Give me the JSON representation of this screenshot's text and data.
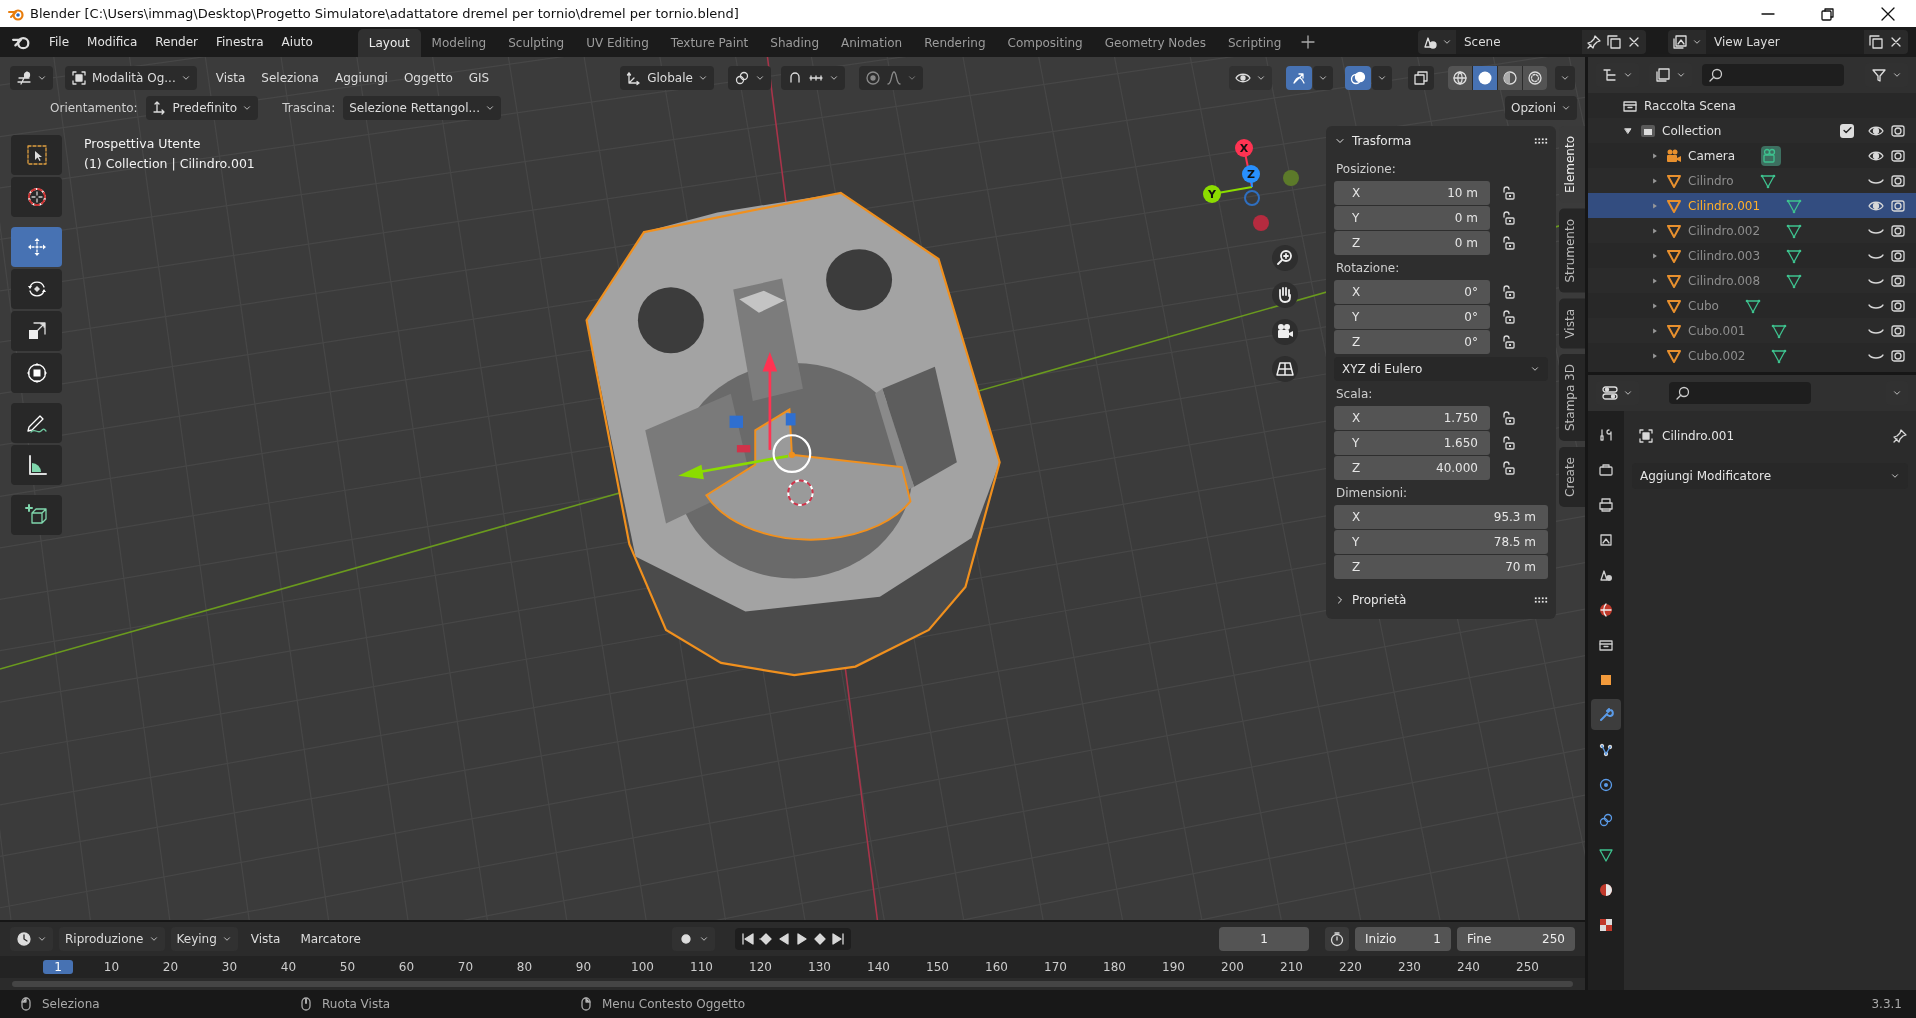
{
  "window": {
    "title": "Blender [C:\\Users\\immag\\Desktop\\Progetto Simulatore\\adattatore dremel per tornio\\dremel per tornio.blend]"
  },
  "menu": [
    "File",
    "Modifica",
    "Render",
    "Finestra",
    "Aiuto"
  ],
  "workspaces": [
    {
      "label": "Layout",
      "selected": true
    },
    {
      "label": "Modeling",
      "selected": false
    },
    {
      "label": "Sculpting",
      "selected": false
    },
    {
      "label": "UV Editing",
      "selected": false
    },
    {
      "label": "Texture Paint",
      "selected": false
    },
    {
      "label": "Shading",
      "selected": false
    },
    {
      "label": "Animation",
      "selected": false
    },
    {
      "label": "Rendering",
      "selected": false
    },
    {
      "label": "Compositing",
      "selected": false
    },
    {
      "label": "Geometry Nodes",
      "selected": false
    },
    {
      "label": "Scripting",
      "selected": false
    }
  ],
  "scene": {
    "name": "Scene"
  },
  "view_layer": {
    "name": "View Layer"
  },
  "viewport": {
    "mode": "Modalità Og...",
    "menus": [
      "Vista",
      "Seleziona",
      "Aggiungi",
      "Oggetto",
      "GIS"
    ],
    "orientation": "Globale",
    "gizmos_on": true,
    "overlays_on": true,
    "xray_on": false,
    "shading": [
      {
        "kind": "wireframe",
        "selected": false
      },
      {
        "kind": "solid",
        "selected": true
      },
      {
        "kind": "material",
        "selected": false
      },
      {
        "kind": "rendered",
        "selected": false
      }
    ],
    "tool_settings": {
      "orientation_label": "Orientamento:",
      "orientation": "Predefinito",
      "drag_label": "Trascina:",
      "drag": "Selezione Rettangol...",
      "options": "Opzioni"
    },
    "info": [
      "Prospettiva Utente",
      "(1) Collection | Cilindro.001"
    ],
    "tool_groups": [
      [
        {
          "kind": "select_box",
          "selected": false
        },
        {
          "kind": "cursor",
          "selected": false
        }
      ],
      [
        {
          "kind": "move",
          "selected": true
        },
        {
          "kind": "rotate",
          "selected": false
        },
        {
          "kind": "scale",
          "selected": false
        },
        {
          "kind": "transform",
          "selected": false
        }
      ],
      [
        {
          "kind": "annotate",
          "selected": false
        },
        {
          "kind": "measure",
          "selected": false
        }
      ],
      [
        {
          "kind": "add_cube",
          "selected": false
        }
      ]
    ],
    "gizmo_axes": [
      "X",
      "Y",
      "Z"
    ]
  },
  "sidebar": {
    "tabs": [
      {
        "label": "Elemento",
        "selected": true
      },
      {
        "label": "Strumento",
        "selected": false
      },
      {
        "label": "Vista",
        "selected": false
      },
      {
        "label": "Stampa 3D",
        "selected": false
      },
      {
        "label": "Create",
        "selected": false
      }
    ],
    "transform": {
      "title": "Trasforma",
      "expanded": true,
      "sections": [
        {
          "label": "Posizione:",
          "kind": "lockable",
          "fields": [
            {
              "axis": "X",
              "value": "10 m"
            },
            {
              "axis": "Y",
              "value": "0 m"
            },
            {
              "axis": "Z",
              "value": "0 m"
            }
          ]
        },
        {
          "label": "Rotazione:",
          "kind": "lockable",
          "fields": [
            {
              "axis": "X",
              "value": "0°"
            },
            {
              "axis": "Y",
              "value": "0°"
            },
            {
              "axis": "Z",
              "value": "0°"
            }
          ],
          "mode": "XYZ di Eulero"
        },
        {
          "label": "Scala:",
          "kind": "lockable",
          "fields": [
            {
              "axis": "X",
              "value": "1.750"
            },
            {
              "axis": "Y",
              "value": "1.650"
            },
            {
              "axis": "Z",
              "value": "40.000"
            }
          ]
        },
        {
          "label": "Dimensioni:",
          "kind": "plain",
          "fields": [
            {
              "axis": "X",
              "value": "95.3 m"
            },
            {
              "axis": "Y",
              "value": "78.5 m"
            },
            {
              "axis": "Z",
              "value": "70 m"
            }
          ]
        }
      ]
    },
    "properties_panel": {
      "title": "Proprietà",
      "expanded": false
    }
  },
  "outliner": {
    "root": "Raccolta Scena",
    "collection": {
      "name": "Collection",
      "expanded": true,
      "checked": true,
      "items": [
        {
          "name": "Camera",
          "kind": "camera",
          "selected": false,
          "visible": true
        },
        {
          "name": "Cilindro",
          "kind": "mesh",
          "selected": false,
          "visible": false
        },
        {
          "name": "Cilindro.001",
          "kind": "mesh",
          "selected": true,
          "visible": true
        },
        {
          "name": "Cilindro.002",
          "kind": "mesh",
          "selected": false,
          "visible": false
        },
        {
          "name": "Cilindro.003",
          "kind": "mesh",
          "selected": false,
          "visible": false
        },
        {
          "name": "Cilindro.008",
          "kind": "mesh",
          "selected": false,
          "visible": false
        },
        {
          "name": "Cubo",
          "kind": "mesh",
          "selected": false,
          "visible": false
        },
        {
          "name": "Cubo.001",
          "kind": "mesh",
          "selected": false,
          "visible": false
        },
        {
          "name": "Cubo.002",
          "kind": "mesh",
          "selected": false,
          "visible": false
        }
      ]
    }
  },
  "properties": {
    "tabs": [
      {
        "kind": "tool",
        "selected": false
      },
      {
        "kind": "render",
        "selected": false
      },
      {
        "kind": "output",
        "selected": false
      },
      {
        "kind": "view_layer",
        "selected": false
      },
      {
        "kind": "scene",
        "selected": false
      },
      {
        "kind": "world",
        "selected": false
      },
      {
        "kind": "collection",
        "selected": false
      },
      {
        "kind": "object",
        "selected": false
      },
      {
        "kind": "modifiers",
        "selected": true
      },
      {
        "kind": "particles",
        "selected": false
      },
      {
        "kind": "physics",
        "selected": false
      },
      {
        "kind": "constraints",
        "selected": false
      },
      {
        "kind": "data",
        "selected": false
      },
      {
        "kind": "material",
        "selected": false
      },
      {
        "kind": "texture",
        "selected": false
      }
    ],
    "object_name": "Cilindro.001",
    "add_modifier": "Aggiungi Modificatore"
  },
  "timeline": {
    "menus": [
      {
        "label": "Riproduzione",
        "kind": "dropdown"
      },
      {
        "label": "Keying",
        "kind": "dropdown"
      },
      {
        "label": "Vista",
        "kind": "menu"
      },
      {
        "label": "Marcatore",
        "kind": "menu"
      }
    ],
    "current_frame": "1",
    "start_label": "Inizio",
    "start": "1",
    "end_label": "Fine",
    "end": "250",
    "ruler": [
      {
        "label": "1",
        "selected": true
      },
      {
        "label": "10",
        "selected": false
      },
      {
        "label": "20",
        "selected": false
      },
      {
        "label": "30",
        "selected": false
      },
      {
        "label": "40",
        "selected": false
      },
      {
        "label": "50",
        "selected": false
      },
      {
        "label": "60",
        "selected": false
      },
      {
        "label": "70",
        "selected": false
      },
      {
        "label": "80",
        "selected": false
      },
      {
        "label": "90",
        "selected": false
      },
      {
        "label": "100",
        "selected": false
      },
      {
        "label": "110",
        "selected": false
      },
      {
        "label": "120",
        "selected": false
      },
      {
        "label": "130",
        "selected": false
      },
      {
        "label": "140",
        "selected": false
      },
      {
        "label": "150",
        "selected": false
      },
      {
        "label": "160",
        "selected": false
      },
      {
        "label": "170",
        "selected": false
      },
      {
        "label": "180",
        "selected": false
      },
      {
        "label": "190",
        "selected": false
      },
      {
        "label": "200",
        "selected": false
      },
      {
        "label": "210",
        "selected": false
      },
      {
        "label": "220",
        "selected": false
      },
      {
        "label": "230",
        "selected": false
      },
      {
        "label": "240",
        "selected": false
      },
      {
        "label": "250",
        "selected": false
      }
    ]
  },
  "status": {
    "hints": [
      {
        "kind": "left",
        "label": "Seleziona"
      },
      {
        "kind": "middle",
        "label": "Ruota Vista"
      },
      {
        "kind": "right",
        "label": "Menu Contesto Oggetto"
      }
    ],
    "version": "3.3.1"
  }
}
